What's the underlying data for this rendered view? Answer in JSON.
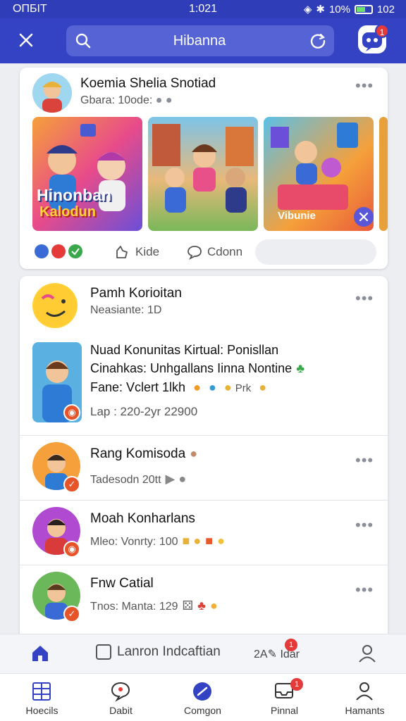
{
  "status_bar": {
    "carrier": "ОПБIT",
    "time": "1:021",
    "battery": "10%",
    "signal": "102"
  },
  "header": {
    "search_placeholder": "Hibanna"
  },
  "header_badge": "1",
  "post1": {
    "title": "Koemia Shelia Snotiad",
    "subtitle": "Gbara: 10ode:",
    "tiles": [
      {
        "label_line1": "Hinonban",
        "label_line2": "Kalodun"
      },
      {
        "label_line1": ""
      },
      {
        "label_line1": "Vibunie"
      }
    ],
    "actions": {
      "like": "Kide",
      "comment": "Cdonn"
    }
  },
  "post2": {
    "title": "Pamh Korioitan",
    "subtitle": "Neasiante: 1D",
    "featured": {
      "line1": "Nuad Konunitas Kirtual: Ponisllan",
      "line2": "Cinahkas: Unhgallans Iinna Nontine",
      "line3": "Fane: Vclert 1lkh",
      "line3_extra": "Prk",
      "line4": "Lap : 220-2yr 22900"
    },
    "rows": [
      {
        "title": "Rang Komisoda",
        "subtitle": "Tadesodn 20tt"
      },
      {
        "title": "Moah Konharlans",
        "subtitle": "Mleo: Vonrty: 100"
      },
      {
        "title": "Fnw Catial",
        "subtitle": "Tnos: Manta: 129"
      }
    ]
  },
  "toolbar2": {
    "item1": "Lanron Indcaftian",
    "item2_prefix": "2A",
    "item2": "Idar",
    "badge": "1"
  },
  "tabs": [
    {
      "label": "Hoecils"
    },
    {
      "label": "Dabit"
    },
    {
      "label": "Comgon"
    },
    {
      "label": "Pinnal",
      "badge": "1"
    },
    {
      "label": "Hamants"
    }
  ],
  "colors": {
    "brand": "#3343c4",
    "accent_red": "#e43a3a"
  }
}
